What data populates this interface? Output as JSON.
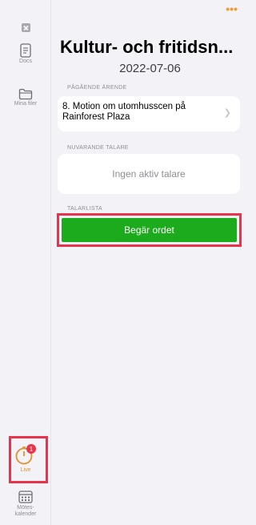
{
  "sidebar": {
    "close_icon": "close-square-icon",
    "items": [
      {
        "label": "Docs",
        "icon": "document-icon"
      },
      {
        "label": "Mina filer",
        "icon": "folder-icon"
      },
      {
        "label": "Live",
        "icon": "stopwatch-icon",
        "badge": "1"
      },
      {
        "label": "Mötes-\nkalender",
        "icon": "calendar-icon"
      }
    ]
  },
  "header": {
    "more_icon": "•••",
    "title": "Kultur- och fritidsn...",
    "date": "2022-07-06"
  },
  "sections": {
    "ongoing_label": "PÅGÅENDE ÄRENDE",
    "ongoing_matter": "8.  Motion om utomhusscen på Rainforest Plaza",
    "current_speaker_label": "NUVARANDE TALARE",
    "no_speaker_text": "Ingen aktiv talare",
    "speaker_list_label": "TALARLISTA",
    "request_button": "Begär ordet"
  },
  "colors": {
    "accent": "#f29a2e",
    "request_button": "#1cab1c",
    "highlight": "#e8344b",
    "badge": "#e8344b"
  }
}
